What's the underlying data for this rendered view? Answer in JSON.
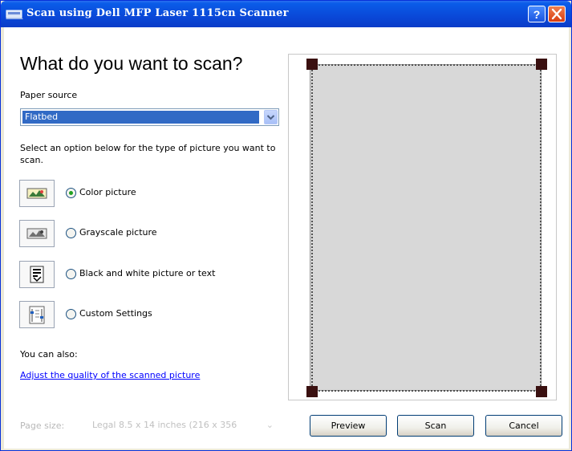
{
  "window": {
    "title": "Scan using Dell MFP Laser 1115cn Scanner"
  },
  "main": {
    "heading": "What do you want to scan?",
    "paper_source_label": "Paper source",
    "paper_source_value": "Flatbed",
    "instructions": "Select an option below for the type of picture you want to scan.",
    "options": [
      {
        "label": "Color picture",
        "icon": "color-picture-icon",
        "checked": true
      },
      {
        "label": "Grayscale picture",
        "icon": "grayscale-picture-icon",
        "checked": false
      },
      {
        "label": "Black and white picture or text",
        "icon": "black-white-text-icon",
        "checked": false
      },
      {
        "label": "Custom Settings",
        "icon": "custom-settings-icon",
        "checked": false
      }
    ],
    "also_label": "You can also:",
    "adjust_link": "Adjust the quality of the scanned picture",
    "page_size_label": "Page size:",
    "page_size_value": "Legal 8.5 x 14 inches (216 x 356"
  },
  "buttons": {
    "preview": "Preview",
    "scan": "Scan",
    "cancel": "Cancel"
  },
  "colors": {
    "titlebar": "#0a48d8",
    "selection": "#316ac5",
    "link": "#0000ff"
  }
}
